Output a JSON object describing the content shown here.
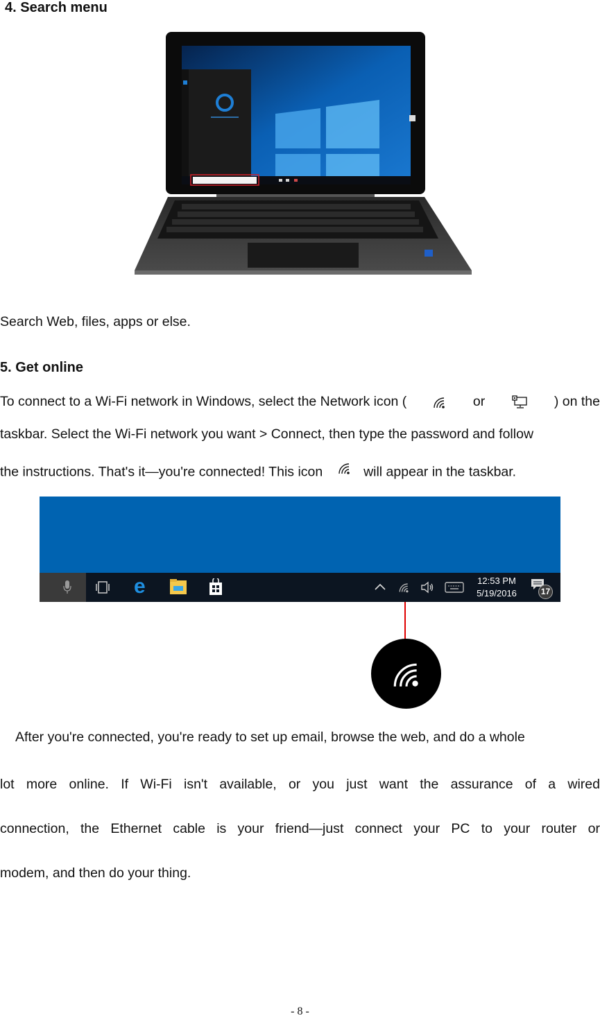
{
  "section4": {
    "heading": "4. Search menu",
    "image_alt": "laptop-with-cortana-search-open",
    "caption": "Search Web, files, apps or else."
  },
  "section5": {
    "heading": "5. Get online",
    "intro_line1_a": "To connect to a Wi-Fi network in Windows, select the Network icon (",
    "intro_line1_or": "or",
    "intro_line1_b": ") on the",
    "intro_line2": "taskbar. Select the Wi-Fi network you want > Connect, then type the password and follow",
    "intro_line3_a": "the instructions. That's it—you're connected! This icon",
    "intro_line3_b": "will appear in the taskbar.",
    "taskbar": {
      "time": "12:53 PM",
      "date": "5/19/2016",
      "notification_count": "17",
      "icons": [
        "microphone-icon",
        "task-view-icon",
        "edge-icon",
        "file-explorer-icon",
        "store-icon",
        "chevron-up-icon",
        "wifi-icon",
        "volume-icon",
        "keyboard-icon",
        "action-center-icon"
      ],
      "colors": {
        "desktop": "#0063b1",
        "taskbar": "#0c1521",
        "edge": "#1e8fe1",
        "folder": "#f5c84c",
        "pointer": "#e00000"
      }
    },
    "body_lines": [
      "After you're connected, you're ready to set up email, browse the web, and do a whole",
      "lot more online. If Wi-Fi isn't available, or you just want the assurance of a wired",
      "connection, the Ethernet cable is your friend—just connect your PC to your router or",
      "modem, and then do your thing."
    ]
  },
  "footer": {
    "page_number": "- 8 -"
  }
}
